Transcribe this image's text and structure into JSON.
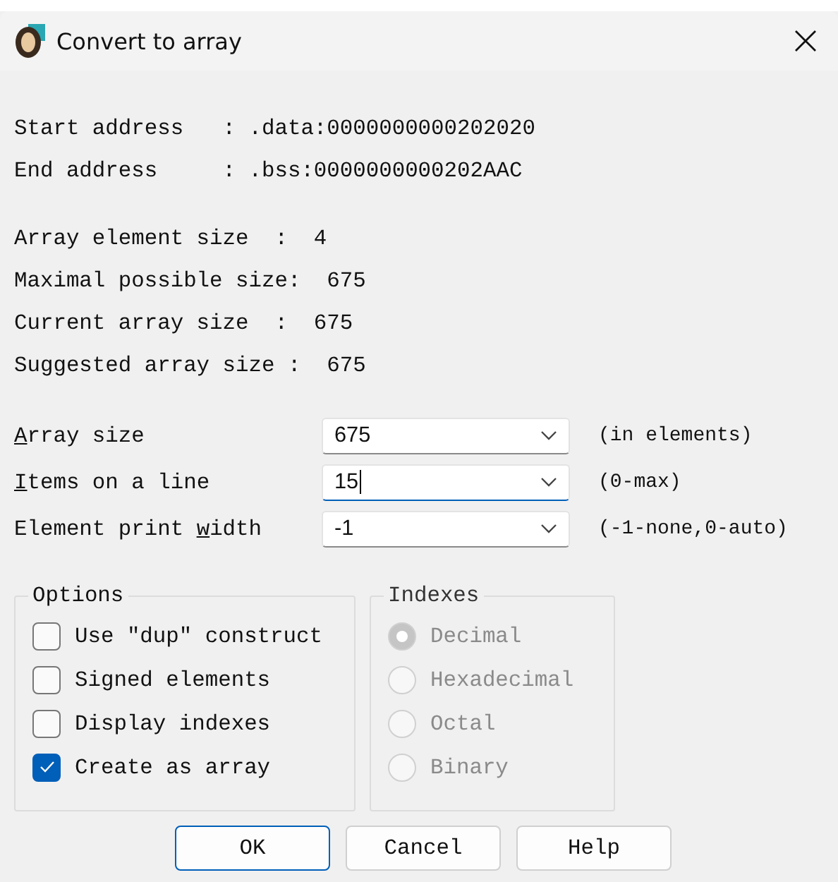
{
  "window": {
    "title": "Convert to array"
  },
  "address_info": [
    "Start address   : .data:0000000000202020",
    "End address     : .bss:0000000000202AAC"
  ],
  "size_info": [
    "Array element size  :  4",
    "Maximal possible size:  675",
    "Current array size  :  675",
    "Suggested array size :  675"
  ],
  "fields": [
    {
      "label_parts": {
        "key": "A",
        "after": "rray size"
      },
      "value": "675",
      "hint": "(in elements)",
      "focused": false
    },
    {
      "label_parts": {
        "key": "I",
        "after": "tems on a line"
      },
      "value": "15",
      "hint": "(0-max)",
      "focused": true
    },
    {
      "label_parts": {
        "before": "Element print ",
        "key": "w",
        "after": "idth"
      },
      "value": "-1",
      "hint": "(-1-none,0-auto)",
      "focused": false
    }
  ],
  "options": {
    "title": "Options",
    "items": [
      {
        "label": "Use \"dup\" construct",
        "checked": false
      },
      {
        "label": "Signed elements",
        "checked": false
      },
      {
        "label": "Display indexes",
        "checked": false
      },
      {
        "label": "Create as array",
        "checked": true
      }
    ]
  },
  "indexes": {
    "title": "Indexes",
    "disabled": true,
    "items": [
      {
        "label": "Decimal",
        "selected": true
      },
      {
        "label": "Hexadecimal",
        "selected": false
      },
      {
        "label": "Octal",
        "selected": false
      },
      {
        "label": "Binary",
        "selected": false
      }
    ]
  },
  "buttons": [
    {
      "label": "OK",
      "default": true
    },
    {
      "label": "Cancel",
      "default": false
    },
    {
      "label": "Help",
      "default": false
    }
  ]
}
